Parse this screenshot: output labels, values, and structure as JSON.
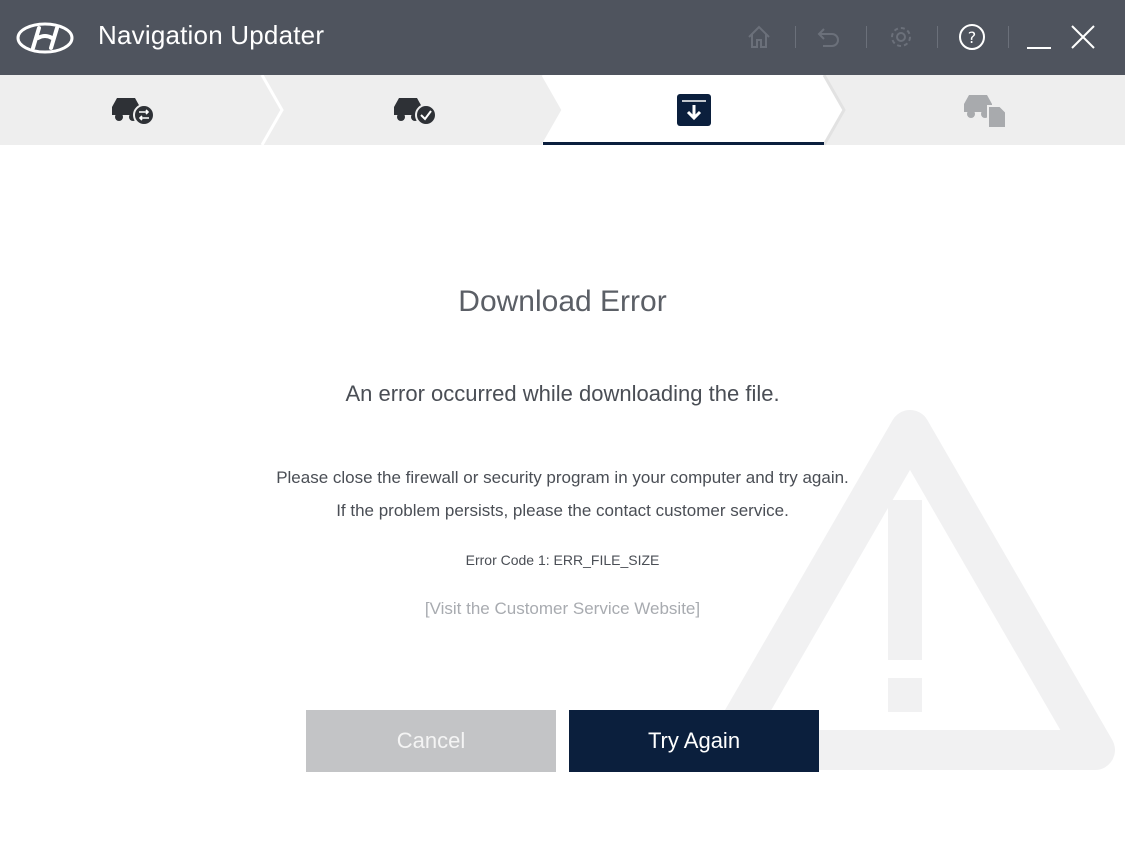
{
  "app": {
    "title": "Navigation Updater",
    "brand": "Hyundai"
  },
  "titlebar": {
    "icons": [
      "home-icon",
      "undo-icon",
      "settings-icon",
      "help-icon",
      "minimize-icon",
      "close-icon"
    ]
  },
  "steps": [
    {
      "icon": "car-sync-icon",
      "state": "done"
    },
    {
      "icon": "car-check-icon",
      "state": "done"
    },
    {
      "icon": "download-icon",
      "state": "active"
    },
    {
      "icon": "car-sdcard-icon",
      "state": "pending"
    }
  ],
  "dialog": {
    "title": "Download Error",
    "message": "An error occurred while downloading the file.",
    "detail_line1": "Please close the firewall or security program in your computer and try again.",
    "detail_line2": "If the problem persists, please the contact customer service.",
    "error_code": "Error Code 1: ERR_FILE_SIZE",
    "link": "[Visit the Customer Service Website]"
  },
  "buttons": {
    "cancel": "Cancel",
    "retry": "Try Again"
  },
  "colors": {
    "titlebar": "#4f545e",
    "stepbar": "#eeeeee",
    "primary": "#0b1f3d",
    "cancel": "#c3c4c6"
  }
}
